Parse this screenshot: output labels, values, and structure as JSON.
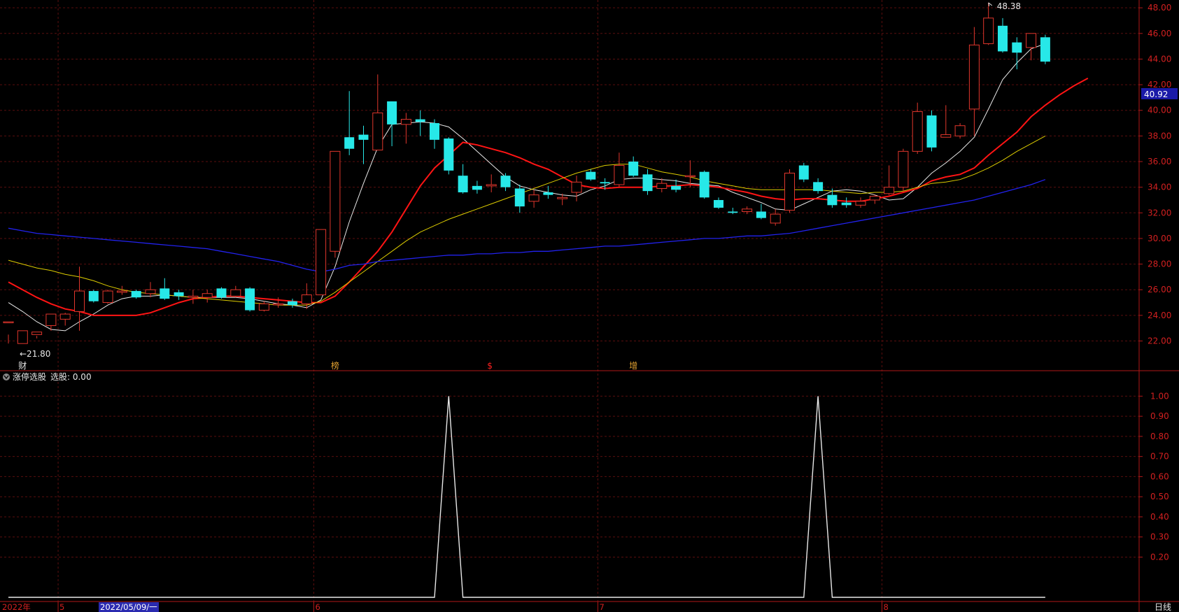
{
  "colors": {
    "background": "#000000",
    "frame": "#b01818",
    "grid": "#5a0e0e",
    "up": "#e0362c",
    "down": "#27e8e8",
    "ma5": "#e8e8e8",
    "ma10": "#ff1414",
    "ma20": "#ddcc00",
    "ma60": "#2222ee",
    "indicator": "#e8e8e8",
    "axis_text": "#d22020",
    "accent_label_bg": "#1a1aa8"
  },
  "main_panel": {
    "current_price": "40.92",
    "high_marker": "48.38",
    "low_marker": "←21.80",
    "event_markers": [
      {
        "text": "财",
        "index": 1,
        "color": "#e8e8e8"
      },
      {
        "text": "榜",
        "index": 23,
        "color": "#e0a030"
      },
      {
        "text": "$",
        "index": 34,
        "color": "#ff2020"
      },
      {
        "text": "增",
        "index": 44,
        "color": "#e0a030"
      }
    ]
  },
  "indicator_panel": {
    "label": "涨停选股",
    "param_label": "选股: 0.00"
  },
  "x_axis": {
    "labels": [
      {
        "text": "2022年",
        "index": 0
      },
      {
        "text": "5",
        "index": 4
      },
      {
        "text": "6",
        "index": 22
      },
      {
        "text": "7",
        "index": 42
      },
      {
        "text": "8",
        "index": 62
      }
    ],
    "cursor_date": "2022/05/09/一",
    "period": "日线"
  },
  "chart_data": [
    {
      "type": "candlestick",
      "title": "",
      "ylim": [
        20.5,
        48.5
      ],
      "yticks": [
        "48.00",
        "46.00",
        "44.00",
        "42.00",
        "40.00",
        "38.00",
        "36.00",
        "34.00",
        "32.00",
        "30.00",
        "28.00",
        "26.00",
        "24.00",
        "22.00"
      ],
      "ytick_values": [
        48,
        46,
        44,
        42,
        40,
        38,
        36,
        34,
        32,
        30,
        28,
        26,
        24,
        22
      ],
      "candles": [
        [
          23.5,
          23.5,
          22.5,
          21.8
        ],
        [
          21.8,
          22.8,
          22.8,
          21.8
        ],
        [
          22.5,
          22.7,
          22.4,
          22.2
        ],
        [
          23.2,
          24.1,
          24.1,
          22.8
        ],
        [
          23.7,
          24.1,
          24.2,
          23.2
        ],
        [
          24.3,
          25.9,
          27.8,
          22.8
        ],
        [
          25.9,
          25.1,
          26.0,
          25.0
        ],
        [
          25.0,
          25.9,
          26.0,
          24.9
        ],
        [
          25.8,
          25.9,
          26.3,
          25.6
        ],
        [
          25.9,
          25.4,
          26.0,
          25.3
        ],
        [
          25.7,
          26.0,
          26.6,
          25.4
        ],
        [
          26.1,
          25.3,
          26.9,
          25.2
        ],
        [
          25.8,
          25.5,
          26.0,
          25.2
        ],
        [
          25.4,
          25.5,
          26.0,
          24.9
        ],
        [
          25.4,
          25.7,
          26.0,
          25.0
        ],
        [
          26.1,
          25.4,
          26.2,
          25.3
        ],
        [
          25.5,
          26.0,
          26.3,
          25.4
        ],
        [
          26.1,
          24.4,
          26.2,
          24.3
        ],
        [
          24.4,
          24.9,
          25.1,
          24.3
        ],
        [
          24.9,
          24.9,
          25.4,
          24.6
        ],
        [
          25.1,
          24.8,
          25.3,
          24.6
        ],
        [
          24.9,
          25.6,
          26.5,
          24.5
        ],
        [
          25.6,
          30.7,
          30.7,
          25.6
        ],
        [
          29.0,
          36.8,
          36.8,
          28.5
        ],
        [
          37.9,
          37.0,
          41.5,
          36.5
        ],
        [
          38.1,
          37.7,
          38.8,
          35.8
        ],
        [
          36.9,
          39.8,
          42.8,
          36.9
        ],
        [
          40.7,
          38.9,
          40.7,
          37.2
        ],
        [
          38.9,
          39.3,
          39.8,
          37.4
        ],
        [
          39.3,
          39.1,
          40.0,
          38.0
        ],
        [
          39.0,
          37.7,
          39.3,
          37.0
        ],
        [
          37.8,
          35.3,
          37.9,
          35.0
        ],
        [
          34.9,
          33.6,
          35.8,
          33.5
        ],
        [
          34.1,
          33.8,
          34.5,
          33.5
        ],
        [
          34.1,
          34.2,
          35.0,
          33.6
        ],
        [
          34.9,
          34.0,
          35.1,
          33.7
        ],
        [
          33.9,
          32.5,
          34.2,
          32.0
        ],
        [
          32.9,
          33.4,
          33.8,
          32.4
        ],
        [
          33.6,
          33.4,
          34.1,
          33.1
        ],
        [
          33.1,
          33.2,
          33.5,
          32.6
        ],
        [
          33.6,
          34.4,
          34.9,
          32.9
        ],
        [
          35.2,
          34.6,
          35.4,
          34.5
        ],
        [
          34.4,
          34.3,
          34.7,
          33.8
        ],
        [
          34.2,
          35.7,
          36.7,
          34.0
        ],
        [
          36.0,
          34.9,
          36.4,
          34.8
        ],
        [
          35.0,
          33.7,
          35.4,
          33.4
        ],
        [
          33.9,
          34.3,
          34.7,
          33.6
        ],
        [
          34.1,
          33.8,
          34.6,
          33.6
        ],
        [
          34.9,
          34.9,
          36.1,
          34.0
        ],
        [
          35.2,
          33.2,
          35.3,
          33.1
        ],
        [
          33.0,
          32.4,
          33.2,
          32.3
        ],
        [
          32.1,
          32.0,
          32.4,
          31.9
        ],
        [
          32.1,
          32.3,
          32.5,
          31.9
        ],
        [
          32.1,
          31.6,
          32.7,
          31.5
        ],
        [
          31.2,
          31.9,
          32.3,
          31.0
        ],
        [
          32.2,
          35.1,
          35.4,
          32.0
        ],
        [
          35.7,
          34.6,
          35.9,
          34.4
        ],
        [
          34.4,
          33.7,
          34.7,
          33.5
        ],
        [
          33.4,
          32.6,
          33.9,
          32.4
        ],
        [
          32.8,
          32.6,
          33.2,
          32.4
        ],
        [
          32.6,
          32.9,
          33.2,
          32.4
        ],
        [
          33.0,
          33.3,
          33.4,
          32.7
        ],
        [
          33.5,
          34.0,
          35.7,
          33.4
        ],
        [
          34.0,
          36.8,
          37.0,
          33.7
        ],
        [
          36.8,
          39.9,
          40.6,
          36.6
        ],
        [
          39.6,
          37.1,
          40.0,
          36.8
        ],
        [
          37.9,
          38.1,
          40.4,
          37.9
        ],
        [
          38.0,
          38.8,
          39.0,
          37.8
        ],
        [
          40.1,
          45.1,
          46.5,
          38.0
        ],
        [
          45.2,
          47.2,
          48.4,
          45.1
        ],
        [
          46.6,
          44.6,
          47.2,
          44.5
        ],
        [
          45.3,
          44.5,
          45.7,
          43.2
        ],
        [
          44.9,
          46.0,
          46.0,
          43.9
        ],
        [
          45.7,
          43.8,
          45.9,
          43.6
        ]
      ],
      "series": [
        {
          "name": "",
          "role": "MA5",
          "values": [
            25.0,
            24.3,
            23.5,
            22.9,
            22.8,
            23.5,
            24.1,
            24.8,
            25.3,
            25.5,
            25.5,
            25.6,
            25.5,
            25.4,
            25.4,
            25.4,
            25.4,
            25.3,
            25.1,
            24.9,
            24.8,
            24.6,
            25.2,
            27.8,
            31.3,
            34.3,
            37.1,
            38.9,
            39.0,
            39.1,
            39.0,
            38.7,
            37.8,
            36.8,
            35.8,
            34.8,
            34.1,
            33.8,
            33.6,
            33.4,
            33.3,
            33.8,
            34.1,
            34.6,
            34.7,
            34.7,
            34.6,
            34.5,
            34.3,
            34.2,
            34.1,
            33.6,
            33.2,
            32.8,
            32.3,
            32.2,
            32.7,
            33.2,
            33.7,
            33.8,
            33.7,
            33.4,
            33.0,
            33.1,
            34.0,
            35.1,
            35.9,
            36.8,
            37.9,
            40.1,
            42.4,
            43.7,
            44.8,
            45.2
          ]
        },
        {
          "name": "",
          "role": "MA10",
          "values": [
            26.6,
            26.0,
            25.4,
            24.9,
            24.5,
            24.3,
            24.0,
            24.0,
            24.0,
            24.0,
            24.2,
            24.6,
            25.0,
            25.3,
            25.4,
            25.5,
            25.5,
            25.4,
            25.3,
            25.2,
            25.1,
            25.0,
            25.0,
            25.5,
            26.6,
            27.8,
            29.0,
            30.5,
            32.3,
            34.1,
            35.5,
            36.5,
            37.5,
            37.3,
            37.0,
            36.7,
            36.3,
            35.8,
            35.4,
            34.8,
            34.2,
            34.0,
            33.9,
            34.0,
            34.0,
            34.0,
            34.1,
            34.1,
            34.2,
            34.1,
            34.0,
            33.8,
            33.6,
            33.3,
            33.1,
            33.0,
            33.1,
            33.1,
            33.0,
            32.9,
            32.9,
            33.1,
            33.3,
            33.6,
            33.9,
            34.5,
            34.8,
            35.0,
            35.5,
            36.5,
            37.4,
            38.3,
            39.5,
            40.4,
            41.2,
            41.9,
            42.5
          ]
        },
        {
          "name": "",
          "role": "MA20",
          "values": [
            28.3,
            28.0,
            27.7,
            27.5,
            27.2,
            27.0,
            26.7,
            26.3,
            26.0,
            25.8,
            25.7,
            25.6,
            25.5,
            25.4,
            25.3,
            25.2,
            25.1,
            25.0,
            24.9,
            24.8,
            24.8,
            24.8,
            25.1,
            25.8,
            26.6,
            27.4,
            28.2,
            29.0,
            29.8,
            30.5,
            31.0,
            31.5,
            31.9,
            32.3,
            32.7,
            33.1,
            33.5,
            33.9,
            34.3,
            34.7,
            35.1,
            35.4,
            35.7,
            35.8,
            35.8,
            35.5,
            35.2,
            35.0,
            34.8,
            34.5,
            34.3,
            34.1,
            33.9,
            33.8,
            33.8,
            33.8,
            33.8,
            33.8,
            33.7,
            33.6,
            33.5,
            33.6,
            33.6,
            33.7,
            34.0,
            34.3,
            34.4,
            34.6,
            35.0,
            35.5,
            36.1,
            36.8,
            37.4,
            38.0
          ]
        },
        {
          "name": "",
          "role": "MA60",
          "values": [
            30.8,
            30.6,
            30.4,
            30.3,
            30.2,
            30.1,
            30.0,
            29.9,
            29.8,
            29.7,
            29.6,
            29.5,
            29.4,
            29.3,
            29.2,
            29.0,
            28.8,
            28.6,
            28.4,
            28.2,
            27.9,
            27.6,
            27.4,
            27.6,
            27.9,
            28.0,
            28.2,
            28.3,
            28.4,
            28.5,
            28.6,
            28.7,
            28.7,
            28.8,
            28.8,
            28.9,
            28.9,
            29.0,
            29.0,
            29.1,
            29.2,
            29.3,
            29.4,
            29.4,
            29.5,
            29.6,
            29.7,
            29.8,
            29.9,
            30.0,
            30.0,
            30.1,
            30.2,
            30.2,
            30.3,
            30.4,
            30.6,
            30.8,
            31.0,
            31.2,
            31.4,
            31.6,
            31.8,
            32.0,
            32.2,
            32.4,
            32.6,
            32.8,
            33.0,
            33.3,
            33.6,
            33.9,
            34.2,
            34.6
          ]
        }
      ]
    },
    {
      "type": "line",
      "title": "",
      "ylim": [
        0,
        1.05
      ],
      "yticks": [
        "1.00",
        "0.90",
        "0.80",
        "0.70",
        "0.60",
        "0.50",
        "0.40",
        "0.30",
        "0.20"
      ],
      "ytick_values": [
        1.0,
        0.9,
        0.8,
        0.7,
        0.6,
        0.5,
        0.4,
        0.3,
        0.2
      ],
      "series": [
        {
          "name": "",
          "values": [
            0,
            0,
            0,
            0,
            0,
            0,
            0,
            0,
            0,
            0,
            0,
            0,
            0,
            0,
            0,
            0,
            0,
            0,
            0,
            0,
            0,
            0,
            0,
            0,
            0,
            0,
            0,
            0,
            0,
            0,
            0,
            1,
            0,
            0,
            0,
            0,
            0,
            0,
            0,
            0,
            0,
            0,
            0,
            0,
            0,
            0,
            0,
            0,
            0,
            0,
            0,
            0,
            0,
            0,
            0,
            0,
            0,
            1,
            0,
            0,
            0,
            0,
            0,
            0,
            0,
            0,
            0,
            0,
            0,
            0,
            0,
            0,
            0,
            0
          ]
        }
      ]
    }
  ]
}
